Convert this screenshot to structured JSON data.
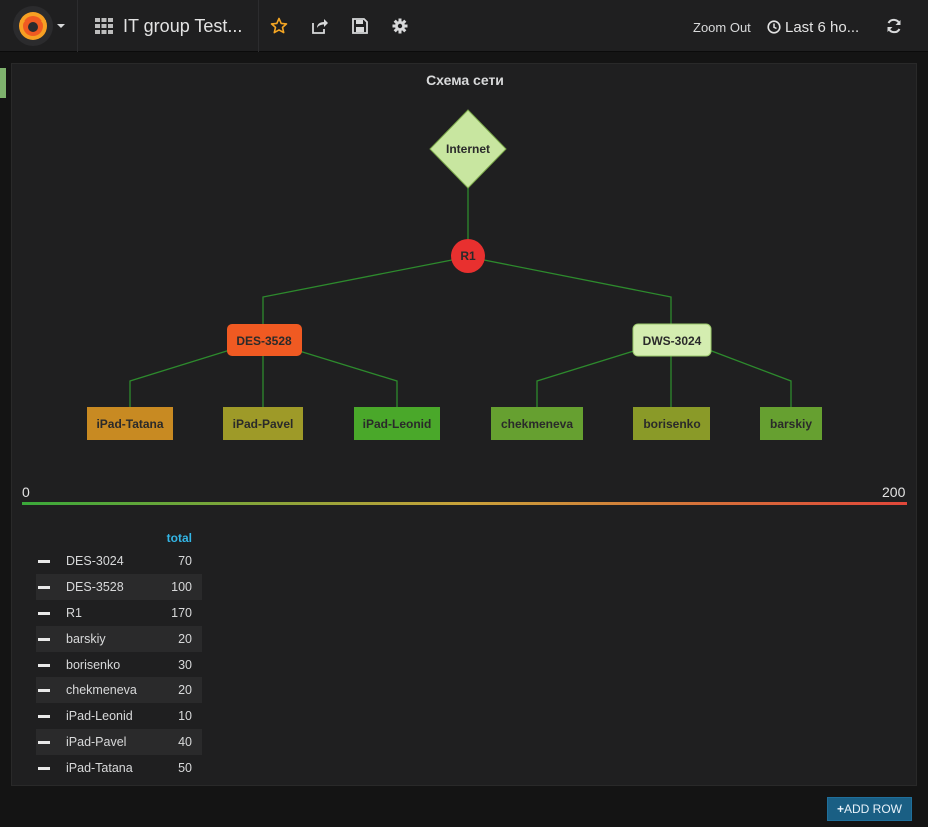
{
  "navbar": {
    "dashboard_title": "IT group Test...",
    "zoom_out": "Zoom Out",
    "time_range": "Last 6 ho..."
  },
  "panel": {
    "title": "Схема сети",
    "nodes": {
      "internet": "Internet",
      "r1": "R1",
      "des3528": "DES-3528",
      "dws3024": "DWS-3024",
      "ipad_tatana": "iPad-Tatana",
      "ipad_pavel": "iPad-Pavel",
      "ipad_leonid": "iPad-Leonid",
      "chekmeneva": "chekmeneva",
      "borisenko": "borisenko",
      "barskiy": "barskiy"
    },
    "node_colors": {
      "internet": "#c8e6a0",
      "r1": "#e8302f",
      "des3528": "#f05a22",
      "dws3024": "#d4edb0",
      "ipad_tatana": "#c88a22",
      "ipad_pavel": "#9e9a28",
      "ipad_leonid": "#4aa82a",
      "chekmeneva": "#66a030",
      "borisenko": "#8a9a28",
      "barskiy": "#66a030"
    },
    "scale": {
      "min": "0",
      "max": "200"
    },
    "legend": {
      "header": "total",
      "rows": [
        {
          "name": "DES-3024",
          "value": "70"
        },
        {
          "name": "DES-3528",
          "value": "100"
        },
        {
          "name": "R1",
          "value": "170"
        },
        {
          "name": "barskiy",
          "value": "20"
        },
        {
          "name": "borisenko",
          "value": "30"
        },
        {
          "name": "chekmeneva",
          "value": "20"
        },
        {
          "name": "iPad-Leonid",
          "value": "10"
        },
        {
          "name": "iPad-Pavel",
          "value": "40"
        },
        {
          "name": "iPad-Tatana",
          "value": "50"
        }
      ]
    }
  },
  "footer": {
    "add_row": "ADD ROW"
  }
}
